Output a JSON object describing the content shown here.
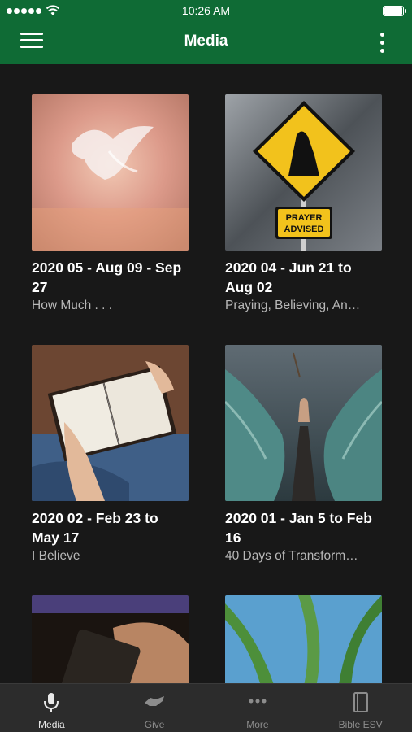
{
  "status_bar": {
    "time": "10:26 AM"
  },
  "header": {
    "title": "Media"
  },
  "media": [
    {
      "title": "2020 05 - Aug 09 - Sep 27",
      "subtitle": "How Much . . ."
    },
    {
      "title": "2020 04 - Jun 21 to Aug 02",
      "subtitle": "Praying, Believing, An…",
      "sign_text_1": "PRAYER",
      "sign_text_2": "ADVISED"
    },
    {
      "title": "2020 02 - Feb 23 to May 17",
      "subtitle": "I Believe"
    },
    {
      "title": "2020 01 - Jan 5 to Feb 16",
      "subtitle": "40 Days of Transform…"
    },
    {
      "title": "",
      "subtitle": ""
    },
    {
      "title": "",
      "subtitle": ""
    }
  ],
  "tabbar": {
    "items": [
      {
        "label": "Media",
        "icon": "microphone-icon",
        "active": true
      },
      {
        "label": "Give",
        "icon": "handshake-icon",
        "active": false
      },
      {
        "label": "More",
        "icon": "more-dots-icon",
        "active": false
      },
      {
        "label": "Bible ESV",
        "icon": "book-icon",
        "active": false
      }
    ]
  },
  "colors": {
    "header_bg": "#0f6b35",
    "background": "#181818",
    "tabbar_bg": "#2c2c2c"
  },
  "battery_level": 1.0
}
